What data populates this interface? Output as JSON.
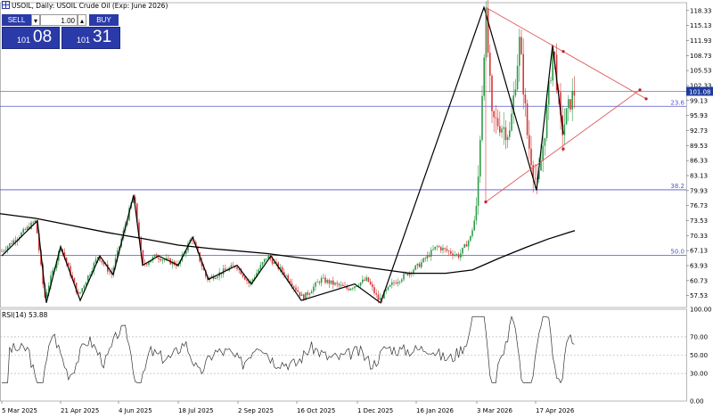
{
  "header": {
    "symbol": "USOIL",
    "timeframe": "Daily",
    "description": "USOIL Crude Oil (Exp: June 2026)",
    "title_text": "USOIL, Daily:  USOIL Crude Oil (Exp: June 2026)"
  },
  "trade_panel": {
    "sell_label": "SELL",
    "buy_label": "BUY",
    "volume": "1.00",
    "sell_prefix": "101",
    "sell_big": "08",
    "buy_prefix": "101",
    "buy_big": "31"
  },
  "rsi": {
    "label": "RSI(14) 53.88",
    "levels": [
      70,
      50,
      30
    ],
    "scale_labels": [
      "100.00",
      "70.00",
      "50.00",
      "30.00",
      "0.00"
    ]
  },
  "colors": {
    "line": "#000000",
    "candle_up": "#2e9c4a",
    "candle_down": "#d63a3a",
    "fib": "#5555cc",
    "triangle": "#e05a5a",
    "price_line": "#7a8fb0",
    "price_tag": "#1f3b9e"
  },
  "chart_data": {
    "type": "candlestick",
    "series_name": "USOIL Crude Oil (Exp: June 2026)",
    "current_price_label": "101.08",
    "price_axis": [
      "118.33",
      "115.13",
      "111.93",
      "108.73",
      "105.53",
      "102.33",
      "99.13",
      "95.93",
      "92.73",
      "89.53",
      "86.33",
      "83.13",
      "79.93",
      "76.73",
      "73.53",
      "70.33",
      "67.13",
      "63.93",
      "60.73",
      "57.53"
    ],
    "x_labels": [
      "5 Mar 2025",
      "21 Apr 2025",
      "4 Jun 2025",
      "18 Jul 2025",
      "2 Sep 2025",
      "16 Oct 2025",
      "1 Dec 2025",
      "16 Jan 2026",
      "3 Mar 2026",
      "17 Apr 2026"
    ],
    "fib_levels": [
      {
        "label": "23.6",
        "price": 97.9
      },
      {
        "label": "38.2",
        "price": 80.1
      },
      {
        "label": "50.0",
        "price": 66.1
      }
    ],
    "current_price": 101.1,
    "ylim": [
      55,
      120
    ]
  }
}
